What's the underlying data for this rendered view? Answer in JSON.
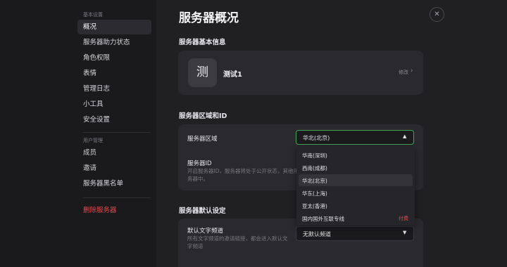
{
  "sidebar": {
    "group1_title": "基本设置",
    "items": [
      {
        "label": "概况"
      },
      {
        "label": "服务器助力状态"
      },
      {
        "label": "角色权限"
      },
      {
        "label": "表情"
      },
      {
        "label": "管理日志"
      },
      {
        "label": "小工具"
      },
      {
        "label": "安全设置"
      }
    ],
    "group2_title": "用户管理",
    "user_items": [
      {
        "label": "成员"
      },
      {
        "label": "邀请"
      },
      {
        "label": "服务器黑名单"
      }
    ],
    "delete_label": "删除服务器"
  },
  "header": {
    "title": "服务器概况",
    "close_icon": "✕"
  },
  "basic_info": {
    "section_title": "服务器基本信息",
    "avatar_char": "测",
    "server_name": "测试1",
    "edit_label": "修改",
    "edit_chevron": "›"
  },
  "region_section": {
    "section_title": "服务器区域和ID",
    "region_label": "服务器区域",
    "selected_region": "华北(北京)",
    "arrow_up": "▲",
    "server_id_label": "服务器ID",
    "server_id_desc_1": "开启服务器ID，服务器将处于公开状态，其他用",
    "server_id_desc_2": "务器中。",
    "options": [
      {
        "label": "华南(深圳)",
        "badge": ""
      },
      {
        "label": "西南(成都)",
        "badge": ""
      },
      {
        "label": "华北(北京)",
        "badge": ""
      },
      {
        "label": "华东(上海)",
        "badge": ""
      },
      {
        "label": "亚太(香港)",
        "badge": ""
      },
      {
        "label": "国内国外互联专线",
        "badge": "付费"
      }
    ]
  },
  "defaults_section": {
    "section_title": "服务器默认设定",
    "channel_label": "默认文字频道",
    "channel_desc_1": "所有文字频道的邀请链接，都会进入默认文",
    "channel_desc_2": "字频道",
    "channel_value": "无默认频道",
    "arrow_down": "▼"
  },
  "colors": {
    "accent_green": "#45a35a",
    "danger_red": "#e5484d"
  }
}
